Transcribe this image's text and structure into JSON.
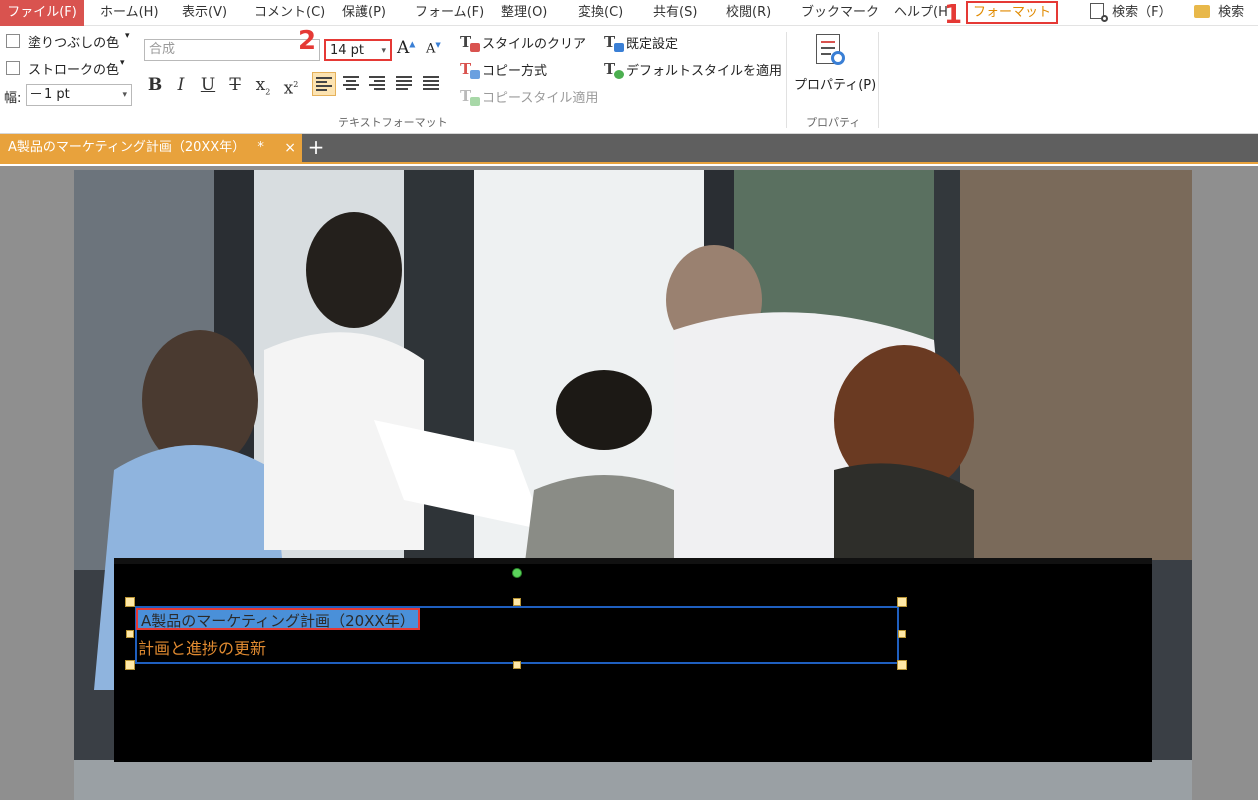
{
  "menu": {
    "file": "ファイル(F)",
    "items": [
      "ホーム(H)",
      "表示(V)",
      "コメント(C)",
      "保護(P)",
      "フォーム(F)",
      "整理(O)",
      "変換(C)",
      "共有(S)",
      "校閲(R)",
      "ブックマーク",
      "ヘルプ(H"
    ],
    "format_tab": "フォーマット",
    "search1": "検索（F）",
    "search2": "検索"
  },
  "steps": {
    "one": "1",
    "two": "2"
  },
  "ribbon": {
    "fill_color": "塗りつぶしの色",
    "stroke_color": "ストロークの色",
    "width_label": "幅:",
    "width_value": "1 pt",
    "font_name": "合成",
    "font_size": "14 pt",
    "bold": "B",
    "italic": "I",
    "underline": "U",
    "strike": "T",
    "subscript": "x",
    "superscript": "x",
    "clear_style": "スタイルのクリア",
    "copy_method": "コピー方式",
    "apply_copy_style": "コピースタイル適用",
    "default_settings": "既定設定",
    "apply_default_style": "デフォルトスタイルを適用",
    "properties": "プロパティ(P)",
    "group_text_format": "テキストフォーマット",
    "group_properties": "プロパティ"
  },
  "tab": {
    "title": "A製品のマーケティング計画（20XX年）",
    "modified": "*",
    "close": "×",
    "add": "+"
  },
  "document": {
    "title_text": "A製品のマーケティング計画（20XX年）",
    "subtitle_text": "計画と進捗の更新"
  },
  "colors": {
    "accent": "#e8a23c",
    "file_menu": "#d9534f",
    "highlight_red": "#e53935",
    "selection_blue": "#1f5fbf"
  }
}
